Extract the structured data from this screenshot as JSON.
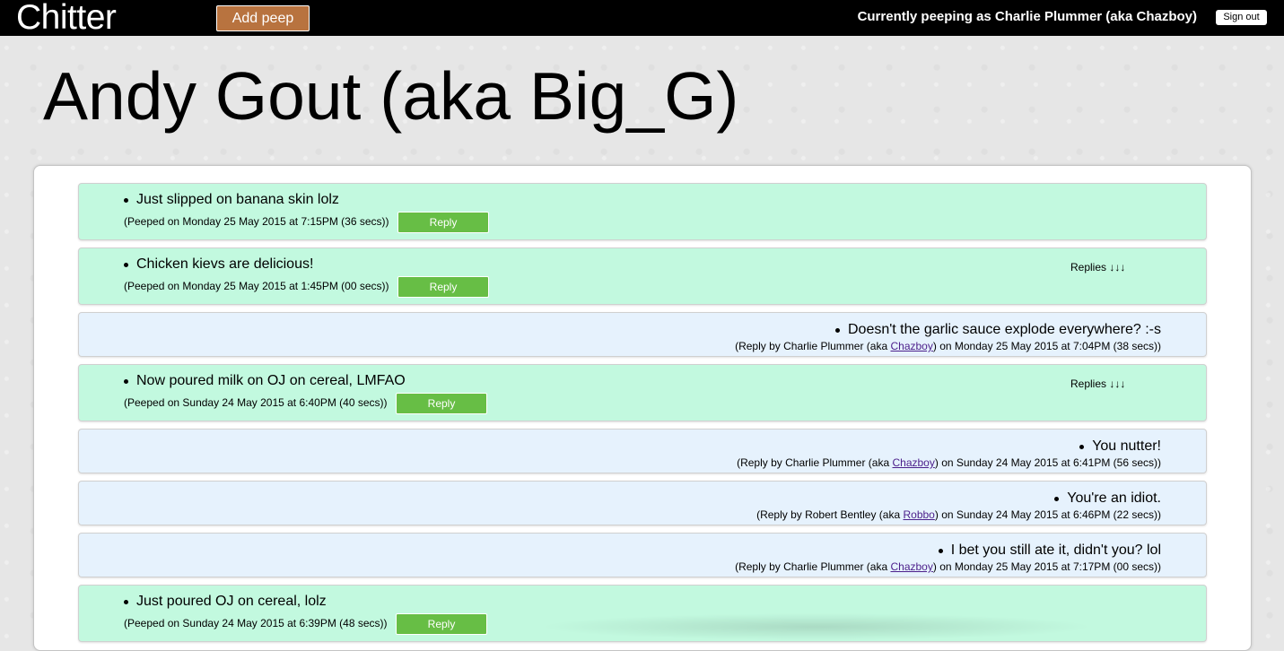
{
  "header": {
    "brand": "Chitter",
    "add_peep_label": "Add peep",
    "peeping_as": "Currently peeping as Charlie Plummer (aka Chazboy)",
    "sign_out_label": "Sign out"
  },
  "page_title": "Andy Gout (aka Big_G)",
  "feed": {
    "replies_toggle_label": "Replies ↓↓↓",
    "reply_button_label": "Reply",
    "peeps": [
      {
        "text": "Just slipped on banana skin lolz",
        "meta": "(Peeped on Monday 25 May 2015 at 7:15PM (36 secs))"
      },
      {
        "text": "Chicken kievs are delicious!",
        "meta": "(Peeped on Monday 25 May 2015 at 1:45PM (00 secs))"
      },
      {
        "text": "Now poured milk on OJ on cereal, LMFAO",
        "meta": "(Peeped on Sunday 24 May 2015 at 6:40PM (40 secs))"
      },
      {
        "text": "Just poured OJ on cereal, lolz",
        "meta": "(Peeped on Sunday 24 May 2015 at 6:39PM (48 secs))"
      }
    ],
    "replies": [
      {
        "text": "Doesn't the garlic sauce explode everywhere? :-s",
        "prefix": "(Reply by Charlie Plummer (aka ",
        "handle": "Chazboy",
        "suffix": ") on Monday 25 May 2015 at 7:04PM (38 secs))"
      },
      {
        "text": "You nutter!",
        "prefix": "(Reply by Charlie Plummer (aka ",
        "handle": "Chazboy",
        "suffix": ") on Sunday 24 May 2015 at 6:41PM (56 secs))"
      },
      {
        "text": "You're an idiot.",
        "prefix": "(Reply by Robert Bentley (aka ",
        "handle": "Robbo",
        "suffix": ") on Sunday 24 May 2015 at 6:46PM (22 secs))"
      },
      {
        "text": "I bet you still ate it, didn't you? lol",
        "prefix": "(Reply by Charlie Plummer (aka ",
        "handle": "Chazboy",
        "suffix": ") on Monday 25 May 2015 at 7:17PM (00 secs))"
      }
    ]
  },
  "colors": {
    "topbar": "#000000",
    "add_peep_button": "#b8733f",
    "peep_background": "#c2f9df",
    "reply_background": "#e6f2fd",
    "reply_button": "#67be45",
    "handle_link": "#4b1e8a"
  }
}
